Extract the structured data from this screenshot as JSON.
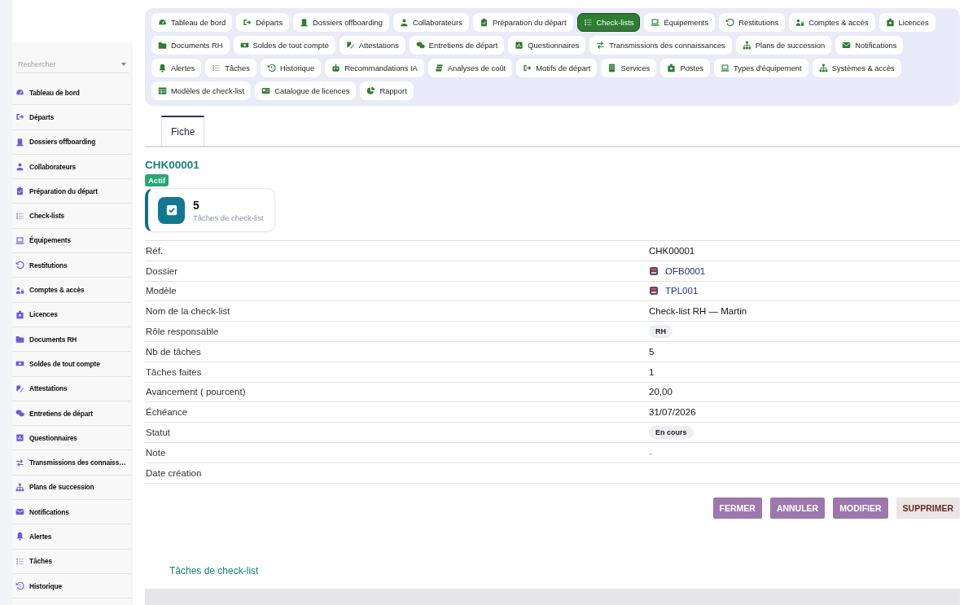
{
  "sidebar": {
    "search": {
      "placeholder": "Rechercher"
    },
    "items": [
      {
        "label": "Tableau de bord",
        "selected": false
      },
      {
        "label": "Départs",
        "selected": false
      },
      {
        "label": "Dossiers offboarding",
        "selected": false
      },
      {
        "label": "Collaborateurs",
        "selected": false
      },
      {
        "label": "Préparation du départ",
        "selected": false
      },
      {
        "label": "Check-lists",
        "selected": false
      },
      {
        "label": "Équipements",
        "selected": false
      },
      {
        "label": "Restitutions",
        "selected": false
      },
      {
        "label": "Comptes & accès",
        "selected": false
      },
      {
        "label": "Licences",
        "selected": false
      },
      {
        "label": "Documents RH",
        "selected": false
      },
      {
        "label": "Soldes de tout compte",
        "selected": false
      },
      {
        "label": "Attestations",
        "selected": false
      },
      {
        "label": "Entretiens de départ",
        "selected": false
      },
      {
        "label": "Questionnaires",
        "selected": false
      },
      {
        "label": "Transmissions des connaiss…",
        "selected": false
      },
      {
        "label": "Plans de succession",
        "selected": false
      },
      {
        "label": "Notifications",
        "selected": false
      },
      {
        "label": "Alertes",
        "selected": false
      },
      {
        "label": "Tâches",
        "selected": false
      },
      {
        "label": "Historique",
        "selected": false
      }
    ]
  },
  "nav": [
    {
      "label": "Tableau de bord",
      "selected": false
    },
    {
      "label": "Départs",
      "selected": false
    },
    {
      "label": "Dossiers offboarding",
      "selected": false
    },
    {
      "label": "Collaborateurs",
      "selected": false
    },
    {
      "label": "Préparation du départ",
      "selected": false
    },
    {
      "label": "Check-lists",
      "selected": true
    },
    {
      "label": "Équipements",
      "selected": false
    },
    {
      "label": "Restitutions",
      "selected": false
    },
    {
      "label": "Comptes & accès",
      "selected": false
    },
    {
      "label": "Licences",
      "selected": false
    },
    {
      "label": "Documents RH",
      "selected": false
    },
    {
      "label": "Soldes de tout compte",
      "selected": false
    },
    {
      "label": "Attestations",
      "selected": false
    },
    {
      "label": "Entretiens de départ",
      "selected": false
    },
    {
      "label": "Questionnaires",
      "selected": false
    },
    {
      "label": "Transmissions des connaissances",
      "selected": false
    },
    {
      "label": "Plans de succession",
      "selected": false
    },
    {
      "label": "Notifications",
      "selected": false
    },
    {
      "label": "Alertes",
      "selected": false
    },
    {
      "label": "Tâches",
      "selected": false
    },
    {
      "label": "Historique",
      "selected": false
    },
    {
      "label": "Recommandations IA",
      "selected": false
    },
    {
      "label": "Analyses de coût",
      "selected": false
    },
    {
      "label": "Motifs de départ",
      "selected": false
    },
    {
      "label": "Services",
      "selected": false
    },
    {
      "label": "Postes",
      "selected": false
    },
    {
      "label": "Types d'équipement",
      "selected": false
    },
    {
      "label": "Systèmes & accès",
      "selected": false
    },
    {
      "label": "Modèles de check-list",
      "selected": false
    },
    {
      "label": "Catalogue de licences",
      "selected": false
    },
    {
      "label": "Rapport",
      "selected": false
    }
  ],
  "tabs": [
    {
      "label": "Fiche",
      "selected": true
    }
  ],
  "record": {
    "title": "CHK00001",
    "status_badge": "Actif",
    "stat_card": {
      "value": "5",
      "label": "Tâches de check-list"
    },
    "fields": [
      {
        "label": "Réf.",
        "kind": "text",
        "value": "CHK00001"
      },
      {
        "label": "Dossier",
        "kind": "link",
        "value": "OFB0001"
      },
      {
        "label": "Modèle",
        "kind": "link",
        "value": "TPL001"
      },
      {
        "label": "Nom de la check-list",
        "kind": "text",
        "value": "Check-list RH — Martin"
      },
      {
        "label": "Rôle responsable",
        "kind": "pill",
        "value": "RH"
      },
      {
        "label": "Nb de tâches",
        "kind": "text",
        "value": "5"
      },
      {
        "label": "Tâches faites",
        "kind": "text",
        "value": "1"
      },
      {
        "label": "Avancement ( pourcent)",
        "kind": "text",
        "value": "20,00"
      },
      {
        "label": "Échéance",
        "kind": "text",
        "value": "31/07/2026"
      },
      {
        "label": "Statut",
        "kind": "pill",
        "value": "En cours"
      },
      {
        "label": "Note",
        "kind": "muted",
        "value": "-"
      },
      {
        "label": "Date création"
      }
    ],
    "buttons": [
      {
        "label": "FERMER",
        "kind": "primary"
      },
      {
        "label": "ANNULER",
        "kind": "primary"
      },
      {
        "label": "MODIFIER",
        "kind": "primary"
      },
      {
        "label": "SUPPRIMER",
        "kind": "danger"
      }
    ]
  },
  "subsection": {
    "title": "Tâches de check-list"
  }
}
